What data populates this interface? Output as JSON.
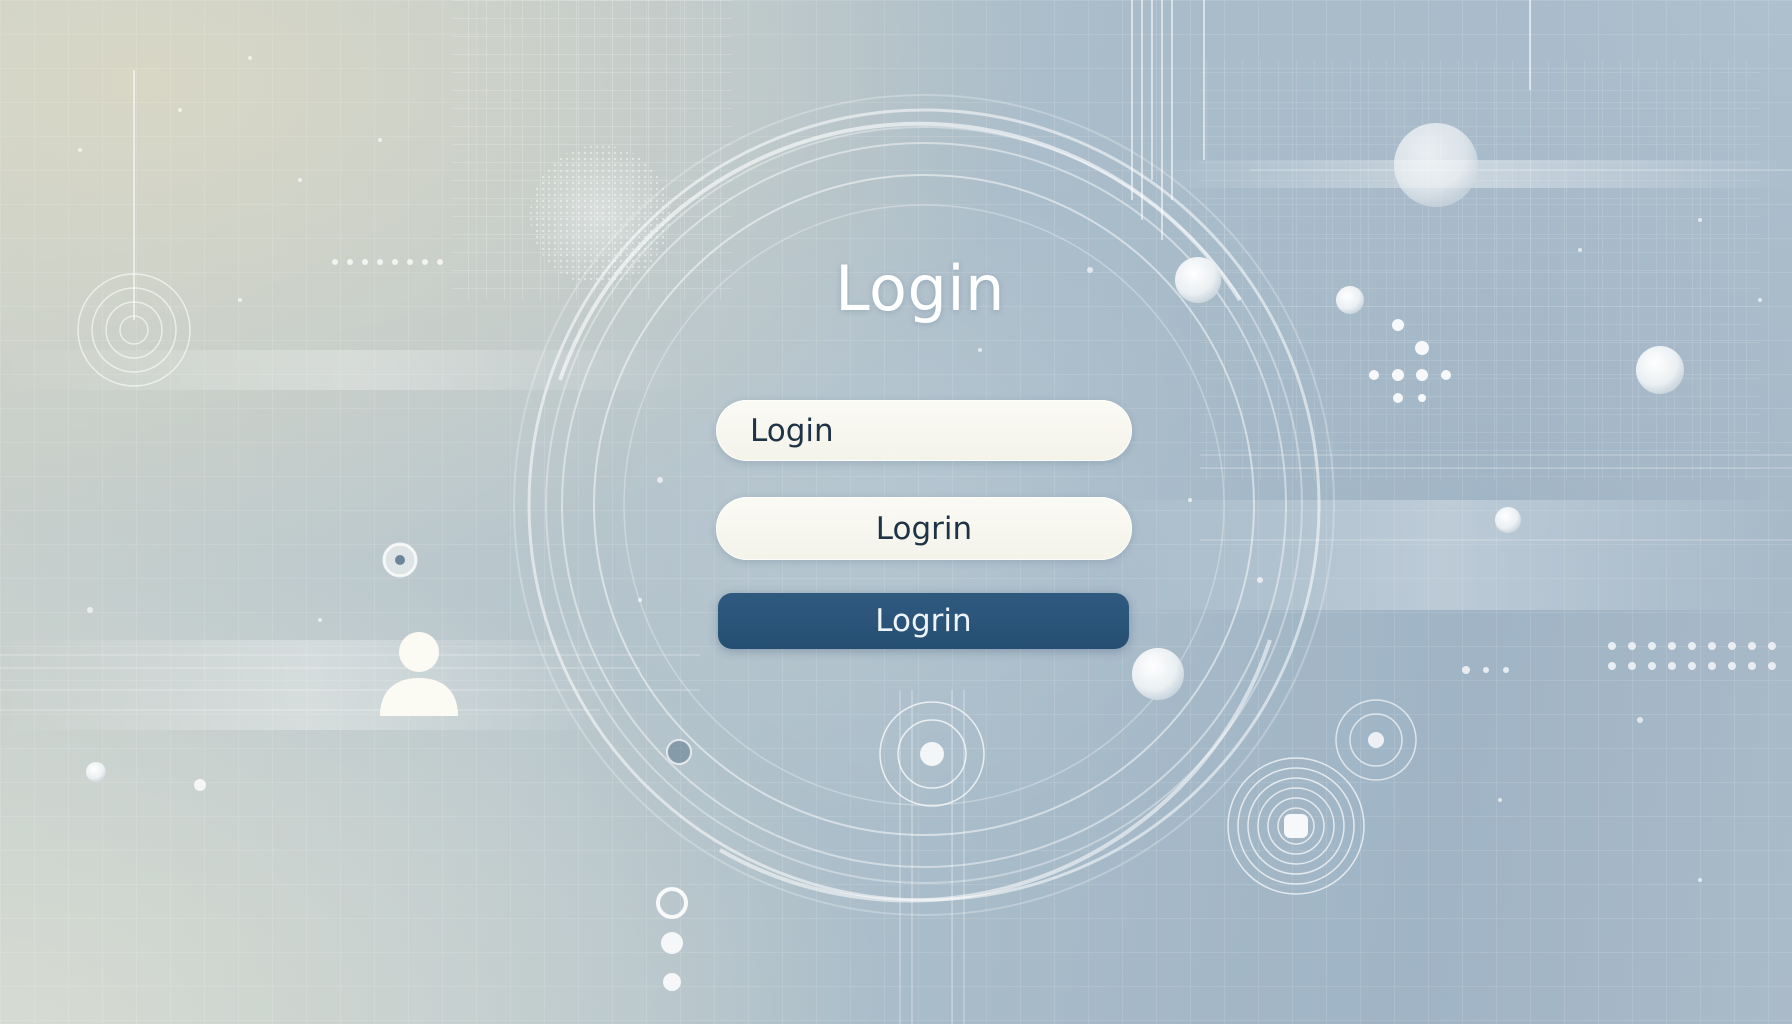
{
  "login_panel": {
    "title": "Login",
    "username_field_value": "Login",
    "password_field_value": "Logrin",
    "submit_label": "Logrin"
  },
  "icons": [
    "user-icon",
    "target-icon"
  ],
  "colors": {
    "accent": "#2b5379",
    "field_background": "#f7f7ef",
    "field_text": "#1f3346",
    "title_text": "#ffffff",
    "background": "#b4c4cd"
  }
}
